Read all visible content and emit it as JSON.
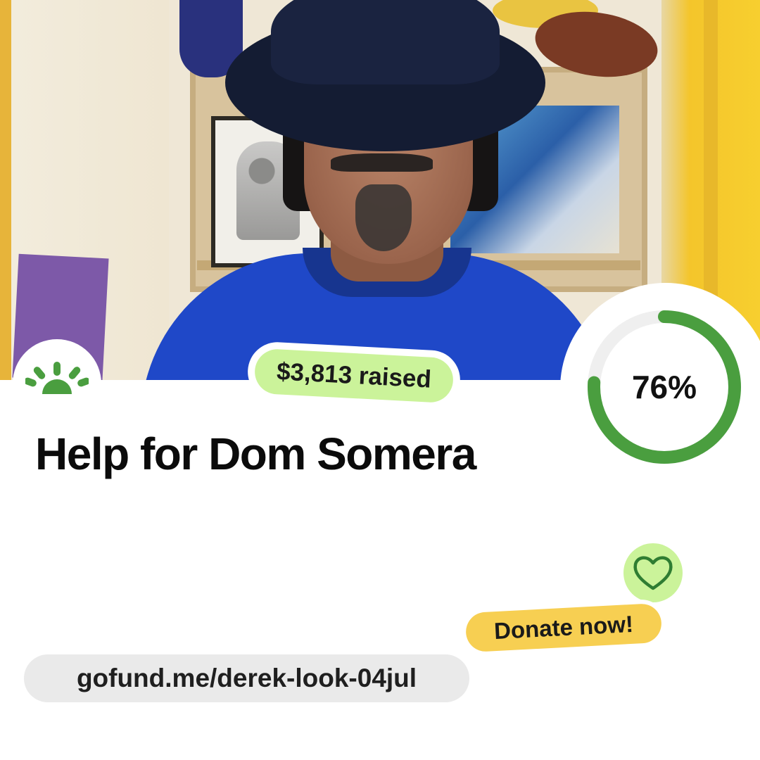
{
  "campaign": {
    "raised_label": "$3,813 raised",
    "progress_percent": 76,
    "progress_label": "76%",
    "title": "Help for Dom Somera",
    "donate_label": "Donate now!",
    "url": "gofund.me/derek-look-04jul"
  },
  "colors": {
    "brand_green": "#4a9e3f",
    "light_green": "#cbf39a",
    "donate_yellow": "#f7cf52",
    "url_gray": "#eaeaea",
    "sweater_blue": "#1f48c8"
  },
  "icons": {
    "logo": "gofundme-sunrise-icon",
    "heart": "heart-icon"
  }
}
